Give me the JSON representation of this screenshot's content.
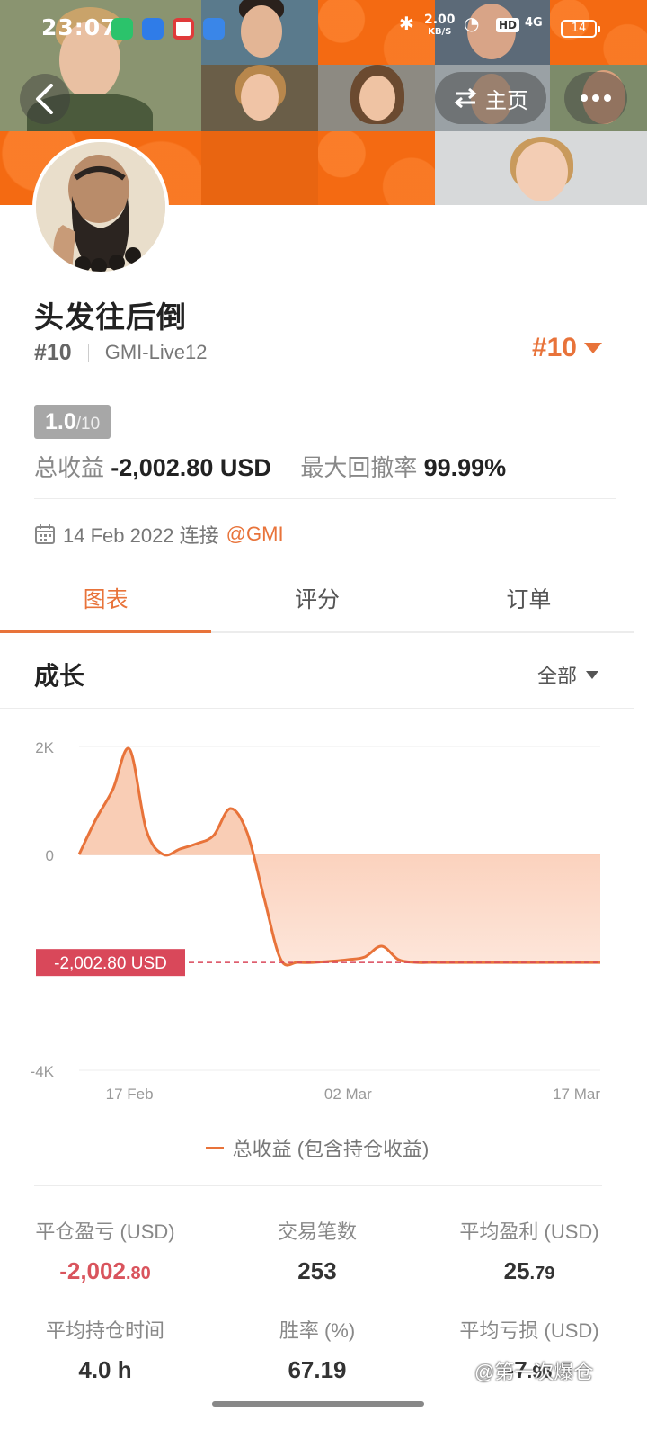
{
  "status_bar": {
    "time": "23:07",
    "net_speed_value": "2.00",
    "net_speed_unit": "KB/S",
    "hd": "HD",
    "signal": "4G",
    "battery": "14"
  },
  "header": {
    "home_label": "主页"
  },
  "profile": {
    "name": "头发往后倒",
    "rank": "#10",
    "server": "GMI-Live12",
    "rank_right": "#10",
    "score": "1.0",
    "score_max": "/10",
    "total_profit_label": "总收益",
    "total_profit_value": "-2,002.80 USD",
    "max_drawdown_label": "最大回撤率",
    "max_drawdown_value": "99.99%",
    "connect_date": "14 Feb 2022 连接",
    "connect_broker": "@GMI"
  },
  "tabs": [
    {
      "label": "图表"
    },
    {
      "label": "评分"
    },
    {
      "label": "订单"
    }
  ],
  "growth": {
    "title": "成长",
    "period": "全部"
  },
  "chart_data": {
    "type": "area",
    "y_ticks": [
      "2K",
      "0",
      "-4K"
    ],
    "x_ticks": [
      "17 Feb",
      "02 Mar",
      "17 Mar"
    ],
    "ylim": [
      -4000,
      2000
    ],
    "current_marker": "-2,002.80 USD",
    "current_value": -2002.8,
    "series": [
      {
        "name": "总收益 (包含持仓收益)",
        "x": [
          "2022-02-14",
          "2022-02-15",
          "2022-02-16",
          "2022-02-17",
          "2022-02-18",
          "2022-02-19",
          "2022-02-20",
          "2022-02-21",
          "2022-02-22",
          "2022-02-23",
          "2022-02-24",
          "2022-02-25",
          "2022-02-26",
          "2022-02-27",
          "2022-02-28",
          "2022-03-01",
          "2022-03-02",
          "2022-03-03",
          "2022-03-04",
          "2022-03-05",
          "2022-03-06",
          "2022-03-07",
          "2022-03-08",
          "2022-03-09",
          "2022-03-10",
          "2022-03-11",
          "2022-03-12",
          "2022-03-13",
          "2022-03-14",
          "2022-03-15",
          "2022-03-16",
          "2022-03-17"
        ],
        "values": [
          0,
          650,
          1200,
          1950,
          450,
          0,
          100,
          200,
          350,
          850,
          400,
          -800,
          -1950,
          -2000,
          -2000,
          -1980,
          -1950,
          -1900,
          -1700,
          -1950,
          -2000,
          -2000,
          -2002.8,
          -2002.8,
          -2002.8,
          -2002.8,
          -2002.8,
          -2002.8,
          -2002.8,
          -2002.8,
          -2002.8,
          -2002.8
        ],
        "color": "#e8733a"
      }
    ],
    "colors": {
      "line": "#e8733a",
      "fill": "#f8c4a8",
      "marker": "#d9485a"
    }
  },
  "legend": {
    "label": "总收益 (包含持仓收益)"
  },
  "stats": [
    {
      "label": "平仓盈亏 (USD)",
      "value_int": "-2,002",
      "value_dec": ".80",
      "negative": true
    },
    {
      "label": "交易笔数",
      "value_int": "253",
      "value_dec": ""
    },
    {
      "label": "平均盈利 (USD)",
      "value_int": "25",
      "value_dec": ".79"
    },
    {
      "label": "平均持仓时间",
      "value_int": "4.0 h",
      "value_dec": ""
    },
    {
      "label": "胜率 (%)",
      "value_int": "67.19",
      "value_dec": ""
    },
    {
      "label": "平均亏损 (USD)",
      "value_int": "-7",
      "value_dec": ".96"
    }
  ],
  "watermark": "@第一次爆仓"
}
